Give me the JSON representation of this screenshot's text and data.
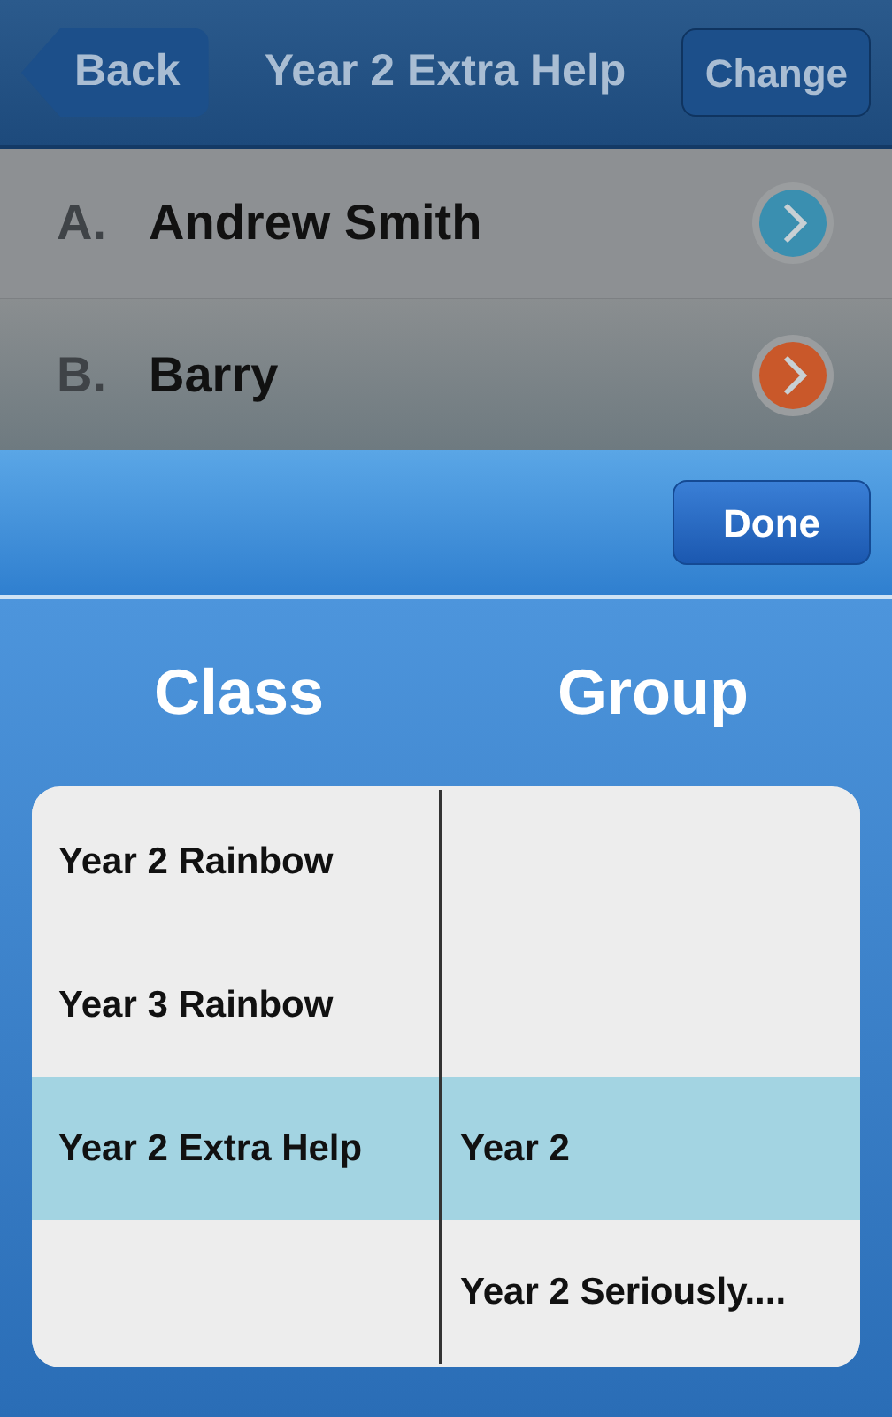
{
  "nav_bar": {
    "back": "Back",
    "title": "Year 2 Extra Help",
    "action": "Change"
  },
  "students": [
    {
      "letter": "A.",
      "name": "Andrew Smith",
      "color": "#3a8fb0"
    },
    {
      "letter": "B.",
      "name": "Barry",
      "color": "#c9582a"
    }
  ],
  "toolbar": {
    "done": "Done"
  },
  "picker": {
    "columns": [
      "Class",
      "Group"
    ],
    "rows": [
      {
        "class": "Year 2 Rainbow",
        "selected": false
      },
      {
        "class": "Year 3 Rainbow",
        "selected": false
      },
      {
        "class": "Year 2 Extra Help",
        "group": "Year 2",
        "selected": true
      },
      {
        "group": "Year 2 Seriously....",
        "selected": false
      }
    ]
  }
}
